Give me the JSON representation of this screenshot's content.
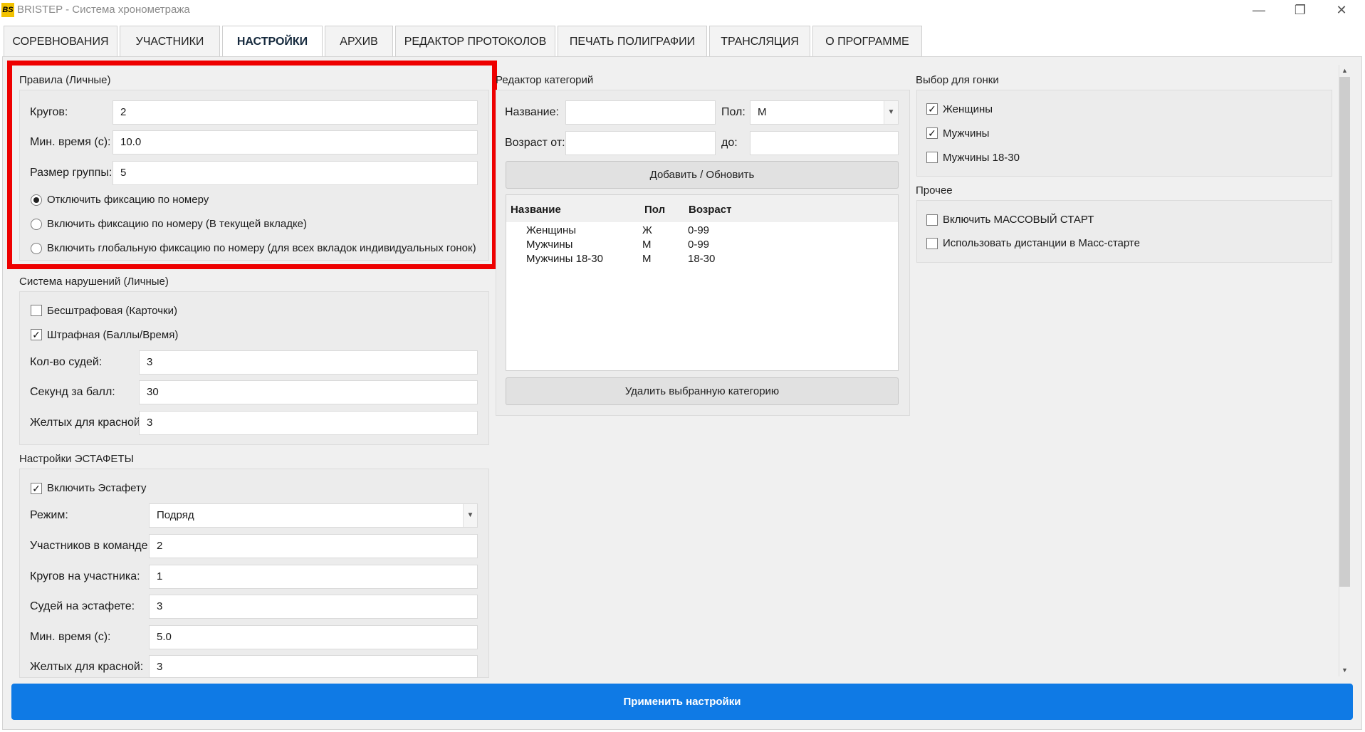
{
  "window": {
    "logo_text": "BS",
    "title": "BRISTEP - Система хронометража",
    "controls": {
      "minimize": "—",
      "maximize": "❐",
      "close": "✕"
    }
  },
  "tabs": [
    {
      "label": "СОРЕВНОВАНИЯ"
    },
    {
      "label": "УЧАСТНИКИ"
    },
    {
      "label": "НАСТРОЙКИ"
    },
    {
      "label": "АРХИВ"
    },
    {
      "label": "РЕДАКТОР ПРОТОКОЛОВ"
    },
    {
      "label": "ПЕЧАТЬ ПОЛИГРАФИИ"
    },
    {
      "label": "ТРАНСЛЯЦИЯ"
    },
    {
      "label": "О ПРОГРАММЕ"
    }
  ],
  "active_tab": "НАСТРОЙКИ",
  "rules": {
    "title": "Правила (Личные)",
    "laps_label": "Кругов:",
    "laps_value": "2",
    "min_time_label": "Мин. время (с):",
    "min_time_value": "10.0",
    "group_size_label": "Размер группы:",
    "group_size_value": "5",
    "radio_options": [
      {
        "label": "Отключить фиксацию по номеру",
        "selected": true
      },
      {
        "label": "Включить фиксацию по номеру (В текущей вкладке)",
        "selected": false
      },
      {
        "label": "Включить глобальную фиксацию по номеру (для всех вкладок индивидуальных гонок)",
        "selected": false
      }
    ]
  },
  "violations": {
    "title": "Система нарушений (Личные)",
    "no_penalty_label": "Бесштрафовая (Карточки)",
    "no_penalty_checked": false,
    "penalty_label": "Штрафная (Баллы/Время)",
    "penalty_checked": true,
    "judges_label": "Кол-во судей:",
    "judges_value": "3",
    "sec_per_point_label": "Секунд за балл:",
    "sec_per_point_value": "30",
    "yellow_for_red_label": "Желтых для красной:",
    "yellow_for_red_value": "3"
  },
  "relay": {
    "title": "Настройки ЭСТАФЕТЫ",
    "enable_label": "Включить Эстафету",
    "enable_checked": true,
    "mode_label": "Режим:",
    "mode_value": "Подряд",
    "team_size_label": "Участников в команде:",
    "team_size_value": "2",
    "laps_per_label": "Кругов на участника:",
    "laps_per_value": "1",
    "judges_label": "Судей на эстафете:",
    "judges_value": "3",
    "min_time_label": "Мин. время (с):",
    "min_time_value": "5.0",
    "yellow_for_red_label": "Желтых для красной:",
    "yellow_for_red_value": "3"
  },
  "categories": {
    "title": "Редактор категорий",
    "name_label": "Название:",
    "name_value": "",
    "gender_label": "Пол:",
    "gender_value": "М",
    "age_from_label": "Возраст от:",
    "age_from_value": "",
    "age_to_label": "до:",
    "age_to_value": "",
    "add_button": "Добавить / Обновить",
    "columns": [
      "Название",
      "Пол",
      "Возраст"
    ],
    "rows": [
      [
        "Женщины",
        "Ж",
        "0-99"
      ],
      [
        "Мужчины",
        "М",
        "0-99"
      ],
      [
        "Мужчины 18-30",
        "М",
        "18-30"
      ]
    ],
    "delete_button": "Удалить выбранную категорию"
  },
  "race_select": {
    "title": "Выбор для гонки",
    "items": [
      {
        "label": "Женщины",
        "checked": true
      },
      {
        "label": "Мужчины",
        "checked": true
      },
      {
        "label": "Мужчины 18-30",
        "checked": false
      }
    ]
  },
  "other": {
    "title": "Прочее",
    "items": [
      {
        "label": "Включить МАССОВЫЙ СТАРТ",
        "checked": false
      },
      {
        "label": "Использовать дистанции в Масс-старте",
        "checked": false
      }
    ]
  },
  "apply_button": "Применить настройки",
  "colors": {
    "accent": "#0f7ae5",
    "highlight": "#ee0000"
  }
}
